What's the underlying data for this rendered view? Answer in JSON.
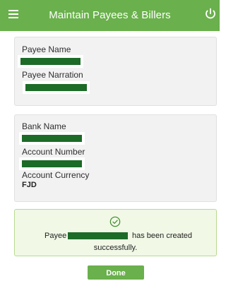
{
  "header": {
    "title": "Maintain Payees & Billers",
    "menu_icon": "hamburger-menu-icon",
    "power_icon": "power-icon",
    "color": "#6ab04c"
  },
  "payee_card": {
    "payee_name_label": "Payee Name",
    "payee_narration_label": "Payee Narration"
  },
  "bank_card": {
    "bank_name_label": "Bank Name",
    "account_number_label": "Account Number",
    "account_currency_label": "Account Currency",
    "account_currency_value": "FJD"
  },
  "success_message": {
    "icon": "check-circle-icon",
    "prefix": "Payee",
    "suffix": "has been created",
    "line2": "successfully."
  },
  "actions": {
    "done_label": "Done"
  }
}
